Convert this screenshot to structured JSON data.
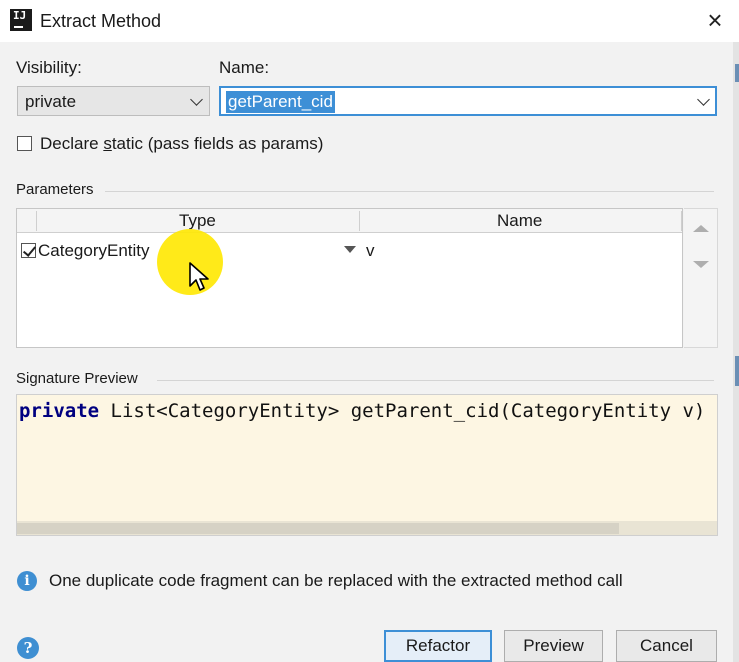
{
  "window": {
    "title": "Extract Method",
    "app_icon": "intellij-idea-icon",
    "close": "×"
  },
  "visibility": {
    "label": "Visibility:",
    "value": "private"
  },
  "name": {
    "label": "Name:",
    "value": "getParent_cid"
  },
  "declare_static": {
    "prefix": "Declare ",
    "underlined": "s",
    "suffix": "tatic (pass fields as params)",
    "checked": false
  },
  "parameters": {
    "section_label": "Parameters",
    "columns": [
      "Type",
      "Name"
    ],
    "rows": [
      {
        "checked": true,
        "type": "CategoryEntity",
        "name": "v"
      }
    ]
  },
  "signature_preview": {
    "section_label": "Signature Preview",
    "keyword": "private",
    "rest": " List<CategoryEntity> getParent_cid(CategoryEntity v)"
  },
  "info": {
    "icon": "i",
    "message": "One duplicate code fragment can be replaced with the extracted method call"
  },
  "help_icon": "?",
  "buttons": {
    "refactor": "Refactor",
    "preview": "Preview",
    "cancel": "Cancel"
  },
  "colors": {
    "accent": "#3d8fd6",
    "code_bg": "#fdf6e3",
    "keyword": "#000080",
    "cursor_highlight": "#ffe800"
  }
}
